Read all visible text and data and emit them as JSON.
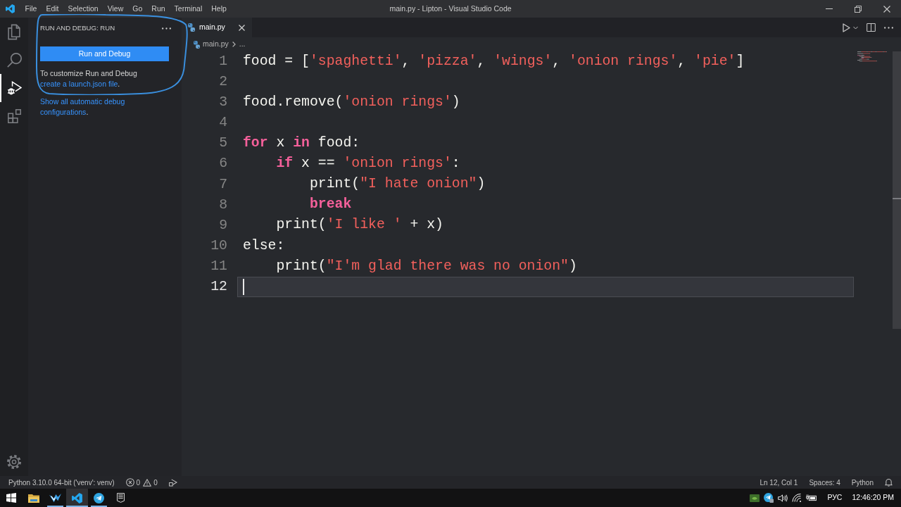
{
  "window": {
    "title": "main.py - Lipton - Visual Studio Code"
  },
  "menu": [
    "File",
    "Edit",
    "Selection",
    "View",
    "Go",
    "Run",
    "Terminal",
    "Help"
  ],
  "activity_bar": [
    {
      "kind": "files",
      "selected": false
    },
    {
      "kind": "search",
      "selected": false
    },
    {
      "kind": "run",
      "selected": true
    },
    {
      "kind": "extensions",
      "selected": false
    }
  ],
  "sidebar": {
    "title": "RUN AND DEBUG: RUN",
    "button": "Run and Debug",
    "hint": {
      "text": "To customize Run and Debug",
      "link": "create a launch.json file",
      "after": "."
    },
    "show_all": {
      "link": "Show all automatic debug configurations",
      "after": "."
    }
  },
  "tabs": [
    {
      "label": "main.py",
      "selected": true
    }
  ],
  "breadcrumb": [
    "main.py",
    "..."
  ],
  "code": {
    "lines": [
      {
        "number": "1",
        "current": false,
        "tokens": [
          {
            "kind": "plain",
            "text": "food = ["
          },
          {
            "kind": "string",
            "text": "'spaghetti'"
          },
          {
            "kind": "plain",
            "text": ", "
          },
          {
            "kind": "string",
            "text": "'pizza'"
          },
          {
            "kind": "plain",
            "text": ", "
          },
          {
            "kind": "string",
            "text": "'wings'"
          },
          {
            "kind": "plain",
            "text": ", "
          },
          {
            "kind": "string",
            "text": "'onion rings'"
          },
          {
            "kind": "plain",
            "text": ", "
          },
          {
            "kind": "string",
            "text": "'pie'"
          },
          {
            "kind": "plain",
            "text": "]"
          }
        ]
      },
      {
        "number": "2",
        "current": false
      },
      {
        "number": "3",
        "current": false,
        "tokens": [
          {
            "kind": "plain",
            "text": "food.remove("
          },
          {
            "kind": "string",
            "text": "'onion rings'"
          },
          {
            "kind": "plain",
            "text": ")"
          }
        ]
      },
      {
        "number": "4",
        "current": false
      },
      {
        "number": "5",
        "current": false,
        "tokens": [
          {
            "kind": "keyword",
            "text": "for"
          },
          {
            "kind": "plain",
            "text": " x "
          },
          {
            "kind": "keyword",
            "text": "in"
          },
          {
            "kind": "plain",
            "text": " food:"
          }
        ],
        "children": [
          {
            "number": "6",
            "current": false,
            "tokens": [
              {
                "kind": "keyword",
                "text": "if"
              },
              {
                "kind": "plain",
                "text": " x == "
              },
              {
                "kind": "string",
                "text": "'onion rings'"
              },
              {
                "kind": "plain",
                "text": ":"
              }
            ],
            "children": [
              {
                "number": "7",
                "current": false,
                "tokens": [
                  {
                    "kind": "plain",
                    "text": "print("
                  },
                  {
                    "kind": "string",
                    "text": "\"I hate onion\""
                  },
                  {
                    "kind": "plain",
                    "text": ")"
                  }
                ]
              },
              {
                "number": "8",
                "current": false,
                "tokens": [
                  {
                    "kind": "keyword",
                    "text": "break"
                  }
                ]
              }
            ]
          },
          {
            "number": "9",
            "current": false,
            "tokens": [
              {
                "kind": "plain",
                "text": "print("
              },
              {
                "kind": "string",
                "text": "'I like '"
              },
              {
                "kind": "plain",
                "text": " + x)"
              }
            ]
          }
        ]
      },
      {
        "number": "10",
        "current": false,
        "tokens": [
          {
            "kind": "plain",
            "text": "else:"
          }
        ],
        "children": [
          {
            "number": "11",
            "current": false,
            "tokens": [
              {
                "kind": "plain",
                "text": "print("
              },
              {
                "kind": "string",
                "text": "\"I'm glad there was no onion\""
              },
              {
                "kind": "plain",
                "text": ")"
              }
            ]
          }
        ]
      },
      {
        "number": "12",
        "current": true
      }
    ]
  },
  "status_bar": {
    "interpreter": "Python 3.10.0 64-bit ('venv': venv)",
    "errors": "0",
    "warnings": "0",
    "position": "Ln 12, Col 1",
    "indent": "Spaces: 4",
    "language": "Python"
  },
  "taskbar": {
    "apps": [
      {
        "kind": "folder",
        "running": false,
        "selected": false
      },
      {
        "kind": "swoosh",
        "running": true,
        "selected": false
      },
      {
        "kind": "code",
        "running": true,
        "selected": true
      },
      {
        "kind": "plane",
        "running": true,
        "selected": false
      },
      {
        "kind": "tile",
        "running": false,
        "selected": false
      }
    ],
    "language": "РУС",
    "time": "12:46:20 PM"
  },
  "annotation": {
    "kind": "freehand-loop"
  }
}
